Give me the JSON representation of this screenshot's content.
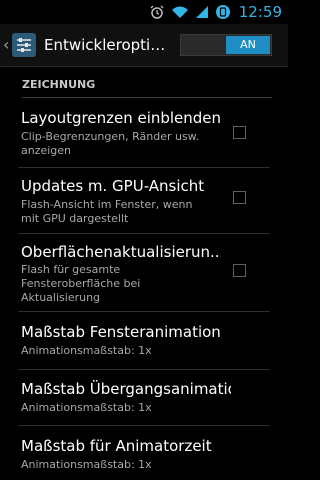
{
  "status_bar": {
    "time": "12:59",
    "icons": [
      "alarm-icon",
      "wifi-icon",
      "signal-icon",
      "battery-icon"
    ]
  },
  "action_bar": {
    "title": "Entwickleroptio…",
    "toggle_label": "AN"
  },
  "section": {
    "header": "ZEICHNUNG"
  },
  "items": [
    {
      "title": "Layoutgrenzen einblenden",
      "summary_line1": "Clip-Begrenzungen, Ränder usw.",
      "summary_line2": "anzeigen",
      "has_checkbox": true
    },
    {
      "title": "Updates m. GPU-Ansicht",
      "summary_line1": "Flash-Ansicht im Fenster, wenn",
      "summary_line2": "mit GPU dargestellt",
      "has_checkbox": true
    },
    {
      "title": "Oberflächenaktualisierun..",
      "summary_line1": "Flash für gesamte",
      "summary_line2": "Fensteroberfläche bei",
      "summary_line3": "Aktualisierung",
      "has_checkbox": true
    },
    {
      "title": "Maßstab Fensteranimation",
      "summary_line1": "Animationsmaßstab: 1x"
    },
    {
      "title": "Maßstab Übergangsanimation",
      "summary_line1": "Animationsmaßstab: 1x"
    },
    {
      "title": "Maßstab für Animatorzeit",
      "summary_line1": "Animationsmaßstab: 1x"
    }
  ],
  "colors": {
    "accent": "#33b5e5",
    "toggle_on": "#1e8ec4"
  }
}
